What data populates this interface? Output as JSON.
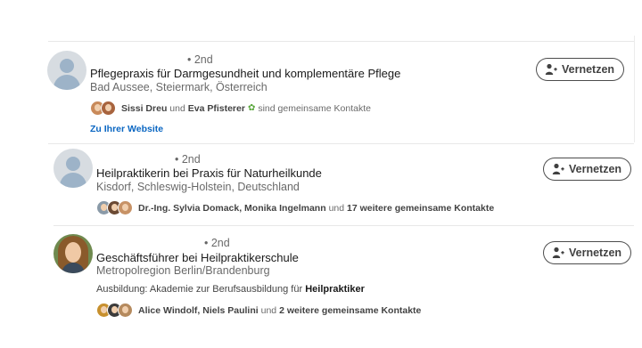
{
  "results": [
    {
      "degree": "• 2nd",
      "headline": "Pflegepraxis für Darmgesundheit und komplementäre Pflege",
      "location": "Bad Aussee, Steiermark, Österreich",
      "mutual": {
        "name1": "Sissi Dreu",
        "joiner": "und",
        "name2": "Eva Pfisterer",
        "suffix": "sind gemeinsame Kontakte"
      },
      "website_link": "Zu Ihrer Website",
      "button_label": "Vernetzen",
      "mini_avatar_colors": [
        "#c98a5a",
        "#a8643e"
      ]
    },
    {
      "degree": "• 2nd",
      "headline": "Heilpraktikerin bei Praxis für Naturheilkunde",
      "location": "Kisdorf, Schleswig-Holstein, Deutschland",
      "mutual": {
        "names": "Dr.-Ing. Sylvia Domack, Monika Ingelmann",
        "joiner": "und",
        "others": "17 weitere gemeinsame Kontakte"
      },
      "button_label": "Vernetzen",
      "mini_avatar_colors": [
        "#8a9aa8",
        "#6b4a34",
        "#c79266"
      ]
    },
    {
      "degree": "• 2nd",
      "headline": "Geschäftsführer bei Heilpraktikerschule",
      "location": "Metropolregion Berlin/Brandenburg",
      "education": {
        "prefix": "Ausbildung: Akademie zur Berufsausbildung für",
        "keyword": "Heilpraktiker"
      },
      "mutual": {
        "names": "Alice Windolf, Niels Paulini",
        "joiner": "und",
        "others": "2 weitere gemeinsame Kontakte"
      },
      "button_label": "Vernetzen",
      "mini_avatar_colors": [
        "#c7902e",
        "#3c3c3c",
        "#b58a5e"
      ]
    }
  ]
}
